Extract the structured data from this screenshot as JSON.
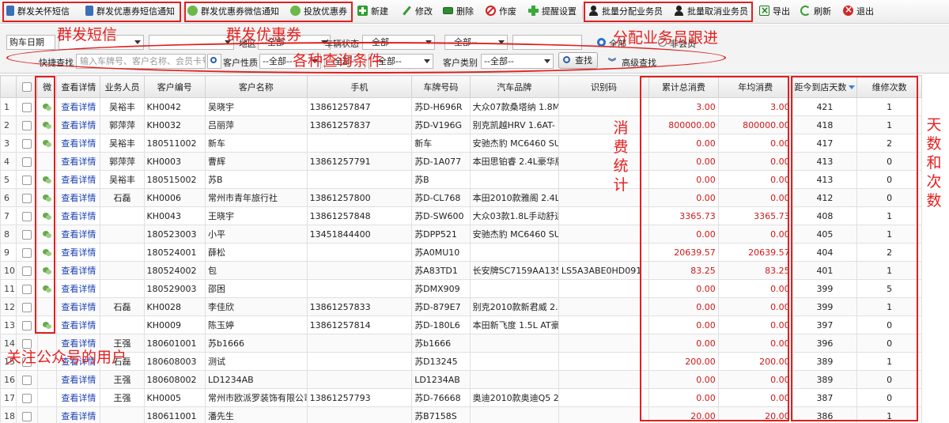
{
  "toolbar": {
    "group_sms": "群发关怀短信",
    "coupon_sms": "群发优惠券短信通知",
    "coupon_wechat": "群发优惠券微信通知",
    "issue_coupon": "投放优惠券",
    "new": "新建",
    "edit": "修改",
    "delete": "删除",
    "void": "作废",
    "reminder": "提醒设置",
    "assign_staff": "批量分配业务员",
    "cancel_staff": "批量取消业务员",
    "export": "导出",
    "refresh": "刷新",
    "exit": "退出"
  },
  "filters": {
    "date_type": "购车日期",
    "region_label": "地区",
    "region_value": "--全部--",
    "vehicle_status_label": "车辆状态",
    "vehicle_status_value": "--全部--",
    "status2_value": "--全部--",
    "radio_all": "全部",
    "radio_member": "非会员",
    "quick_search_label": "快捷查找",
    "quick_search_placeholder": "输入车牌号、客户名称、会员卡号",
    "customer_nature_label": "客户性质",
    "customer_nature_value": "--全部--",
    "extra_value": "--全部--",
    "extra2_value": "--全部--",
    "customer_type_label": "客户类别",
    "customer_type_value": "--全部--",
    "search_button": "查找",
    "advanced_search": "高级查找"
  },
  "table": {
    "headers": [
      "",
      "微",
      "查看详情",
      "业务人员",
      "客户编号",
      "客户名称",
      "手机",
      "车牌号码",
      "汽车品牌",
      "识别码",
      "累计总消费",
      "年均消费",
      "距今到店天数",
      "维修次数"
    ],
    "rows": [
      {
        "n": "1",
        "wx": true,
        "link": "查看详情",
        "staff": "吴裕丰",
        "code": "KH0042",
        "name": "吴晓宇",
        "phone": "13861257847",
        "plate": "苏D-H696R",
        "brand": "大众07款桑塔纳 1.8M",
        "vin": "",
        "total": "3.00",
        "avg": "3.00",
        "days": "421",
        "times": "1"
      },
      {
        "n": "2",
        "wx": true,
        "link": "查看详情",
        "staff": "郭萍萍",
        "code": "KH0032",
        "name": "吕丽萍",
        "phone": "13861257837",
        "plate": "苏D-V196G",
        "brand": "别克凯越HRV 1.6AT-",
        "vin": "",
        "total": "800000.00",
        "avg": "800000.00",
        "days": "418",
        "times": "1"
      },
      {
        "n": "3",
        "wx": true,
        "link": "查看详情",
        "staff": "吴裕丰",
        "code": "180511002",
        "name": "新车",
        "phone": "",
        "plate": "新车",
        "brand": "安驰杰豹 MC6460 SUV",
        "vin": "",
        "total": "0.00",
        "avg": "0.00",
        "days": "417",
        "times": "2"
      },
      {
        "n": "4",
        "wx": false,
        "link": "查看详情",
        "staff": "郭萍萍",
        "code": "KH0003",
        "name": "曹辉",
        "phone": "13861257791",
        "plate": "苏D-1A077",
        "brand": "本田思铂睿 2.4L豪华版",
        "vin": "",
        "total": "0.00",
        "avg": "0.00",
        "days": "413",
        "times": "0"
      },
      {
        "n": "5",
        "wx": true,
        "link": "查看详情",
        "staff": "吴裕丰",
        "code": "180515002",
        "name": "苏B",
        "phone": "",
        "plate": "苏B",
        "brand": "",
        "vin": "",
        "total": "0.00",
        "avg": "0.00",
        "days": "413",
        "times": "0"
      },
      {
        "n": "6",
        "wx": true,
        "link": "查看详情",
        "staff": "石磊",
        "code": "KH0006",
        "name": "常州市青年旅行社",
        "phone": "13861257800",
        "plate": "苏D-CL768",
        "brand": "本田2010款雅阁 2.4L",
        "vin": "",
        "total": "0.00",
        "avg": "0.00",
        "days": "412",
        "times": "0"
      },
      {
        "n": "7",
        "wx": true,
        "link": "查看详情",
        "staff": "",
        "code": "KH0043",
        "name": "王晓宇",
        "phone": "13861257848",
        "plate": "苏D-SW600",
        "brand": "大众03款1.8L手动舒适",
        "vin": "",
        "total": "3365.73",
        "avg": "3365.73",
        "days": "408",
        "times": "1"
      },
      {
        "n": "8",
        "wx": true,
        "link": "查看详情",
        "staff": "",
        "code": "180523003",
        "name": "小平",
        "phone": "13451844400",
        "plate": "苏DPP521",
        "brand": "安驰杰豹 MC6460 SUV",
        "vin": "",
        "total": "0.00",
        "avg": "0.00",
        "days": "405",
        "times": "1"
      },
      {
        "n": "9",
        "wx": true,
        "link": "查看详情",
        "staff": "",
        "code": "180524001",
        "name": "薛松",
        "phone": "",
        "plate": "苏A0MU10",
        "brand": "",
        "vin": "",
        "total": "20639.57",
        "avg": "20639.57",
        "days": "404",
        "times": "2"
      },
      {
        "n": "10",
        "wx": true,
        "link": "查看详情",
        "staff": "",
        "code": "180524002",
        "name": "包",
        "phone": "",
        "plate": "苏A83TD1",
        "brand": "长安牌SC7159AA135",
        "vin": "LS5A3ABE0HD091",
        "total": "83.25",
        "avg": "83.25",
        "days": "401",
        "times": "1"
      },
      {
        "n": "11",
        "wx": true,
        "link": "查看详情",
        "staff": "",
        "code": "180529003",
        "name": "邵困",
        "phone": "",
        "plate": "苏DMX909",
        "brand": "",
        "vin": "",
        "total": "0.00",
        "avg": "0.00",
        "days": "399",
        "times": "5"
      },
      {
        "n": "12",
        "wx": false,
        "link": "查看详情",
        "staff": "石磊",
        "code": "KH0028",
        "name": "李佳欣",
        "phone": "13861257833",
        "plate": "苏D-879E7",
        "brand": "别克2010款新君威 2.0",
        "vin": "",
        "total": "0.00",
        "avg": "0.00",
        "days": "399",
        "times": "1"
      },
      {
        "n": "13",
        "wx": true,
        "link": "查看详情",
        "staff": "",
        "code": "KH0009",
        "name": "陈玉婷",
        "phone": "13861257814",
        "plate": "苏D-180L6",
        "brand": "本田新飞度 1.5L AT豪华",
        "vin": "",
        "total": "0.00",
        "avg": "0.00",
        "days": "397",
        "times": "0"
      },
      {
        "n": "14",
        "wx": false,
        "link": "查看详情",
        "staff": "王强",
        "code": "180601001",
        "name": "苏b1666",
        "phone": "",
        "plate": "苏b1666",
        "brand": "",
        "vin": "",
        "total": "0.00",
        "avg": "0.00",
        "days": "396",
        "times": "0"
      },
      {
        "n": "15",
        "wx": false,
        "link": "查看详情",
        "staff": "石磊",
        "code": "180608003",
        "name": "测试",
        "phone": "",
        "plate": "苏D13245",
        "brand": "",
        "vin": "",
        "total": "200.00",
        "avg": "200.00",
        "days": "389",
        "times": "1"
      },
      {
        "n": "16",
        "wx": false,
        "link": "查看详情",
        "staff": "王强",
        "code": "180608002",
        "name": "LD1234AB",
        "phone": "",
        "plate": "LD1234AB",
        "brand": "",
        "vin": "",
        "total": "0.00",
        "avg": "0.00",
        "days": "389",
        "times": "0"
      },
      {
        "n": "17",
        "wx": false,
        "link": "查看详情",
        "staff": "王强",
        "code": "KH0005",
        "name": "常州市欧派罗装饰有限公司",
        "phone": "13861257793",
        "plate": "苏D-76668",
        "brand": "奥迪2010款奥迪Q5 2.0",
        "vin": "",
        "total": "0.00",
        "avg": "0.00",
        "days": "387",
        "times": "0"
      },
      {
        "n": "18",
        "wx": false,
        "link": "查看详情",
        "staff": "",
        "code": "180611001",
        "name": "潘先生",
        "phone": "",
        "plate": "苏B7158S",
        "brand": "",
        "vin": "",
        "total": "20.00",
        "avg": "20.00",
        "days": "386",
        "times": "1"
      }
    ]
  },
  "annotations": {
    "group_sms": "群发短信",
    "coupon": "群发优惠券",
    "assign": "分配业务员跟进",
    "query": "各种查询条件",
    "consumption": "消费统计",
    "days_times": "天数和次数",
    "followers": "关注公众号的用户"
  },
  "colors": {
    "annotation": "#e02020",
    "link": "#1a3fb5",
    "amount": "#d01818"
  }
}
